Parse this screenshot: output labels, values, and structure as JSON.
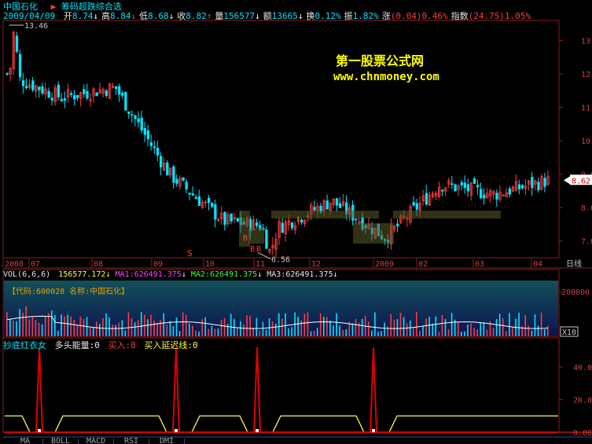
{
  "stock": {
    "name": "中国石化",
    "formula_name": "筹码超跌综合选",
    "date": "2009/04/09"
  },
  "quote": [
    {
      "label": "开",
      "value": "8.74",
      "arrow": "↓",
      "arrow_color": "#ffffff"
    },
    {
      "label": "高",
      "value": "8.84",
      "arrow": "↓",
      "arrow_color": "#ff3c3c"
    },
    {
      "label": "低",
      "value": "8.68",
      "arrow": "↓",
      "arrow_color": "#ffffff"
    },
    {
      "label": "收",
      "value": "8.82",
      "arrow": "↑",
      "arrow_color": "#ff3c3c"
    },
    {
      "label": "量",
      "value": "156577",
      "arrow": "↓",
      "arrow_color": "#ffffff"
    },
    {
      "label": "额",
      "value": "13665",
      "arrow": "↓",
      "arrow_color": "#ffffff"
    },
    {
      "label": "换",
      "value": "0.12%",
      "arrow": "",
      "arrow_color": ""
    },
    {
      "label": "振",
      "value": "1.82%",
      "arrow": "",
      "arrow_color": ""
    },
    {
      "label": "涨",
      "value": "(0.04)0.46%",
      "arrow": "",
      "arrow_color": ""
    },
    {
      "label": "指数",
      "value": "(24.75)1.05%",
      "arrow": "",
      "arrow_color": ""
    }
  ],
  "watermark": {
    "line1": "第一股票公式网",
    "line2": "www.chnmoney.com"
  },
  "price_axis": {
    "ticks": [
      "13.00",
      "12.00",
      "11.00",
      "10.00",
      "9.00",
      "8.00",
      "7.00"
    ],
    "current_price": "8.62"
  },
  "annotations": {
    "high": "13.46",
    "low": "6.56",
    "s_marker": "S",
    "b_marker": "B"
  },
  "time_axis": {
    "labels": [
      "2008",
      "07",
      "08",
      "09",
      "10",
      "11",
      "12",
      "2009",
      "02",
      "03",
      "04"
    ],
    "period": "日线"
  },
  "volume": {
    "title": "VOL(6,6,6)",
    "vol_value": "156577.172",
    "vol_arrow": "↓",
    "ma1": "MA1:626491.375",
    "ma1_arrow": "↓",
    "ma2": "MA2:626491.375",
    "ma2_arrow": "↓",
    "ma3": "MA3:626491.375",
    "ma3_arrow": "↓",
    "info": "【代码:600028 名称:中国石化】",
    "axis_tick": "200000",
    "multiplier": "X10"
  },
  "indicator": {
    "name": "抄底红衣女",
    "l1": "多头能量:0",
    "l2": "买入:0",
    "l3": "买入延迟线:0",
    "ticks": [
      "40.00",
      "20.00",
      "0.00"
    ]
  },
  "tabs": [
    "MA",
    "BOLL",
    "MACD",
    "RSI",
    "DMI"
  ],
  "colors": {
    "background": "#000000",
    "up": "#ff3c3c",
    "down": "#00e5ff",
    "grid": "#8a1e1e",
    "ma_line": "#ffffff",
    "signal_line": "#ffff50",
    "indicator_red": "#e00000"
  },
  "chart_data": [
    {
      "type": "candlestick",
      "title": "中国石化",
      "x": [
        "2008/06",
        "2008/07",
        "2008/08",
        "2008/09",
        "2008/10",
        "2008/11",
        "2008/12",
        "2009/01",
        "2009/02",
        "2009/03",
        "2009/04"
      ],
      "close": [
        12.0,
        11.3,
        11.6,
        9.0,
        7.6,
        7.4,
        8.2,
        7.1,
        8.7,
        8.4,
        8.82
      ],
      "ylim": [
        6.5,
        13.6
      ],
      "high": 13.46,
      "low": 6.56
    },
    {
      "type": "bar",
      "title": "VOL(6,6,6)",
      "ylim": [
        0,
        250000
      ]
    },
    {
      "type": "line",
      "title": "抄底红衣女",
      "series": [
        {
          "name": "多头能量",
          "values": [
            0,
            52,
            0,
            0,
            52,
            0,
            0,
            52,
            0,
            0,
            52,
            0
          ]
        },
        {
          "name": "买入延迟线",
          "values": [
            10,
            10,
            0,
            10,
            10,
            0,
            10,
            10,
            0,
            10,
            10,
            0
          ]
        }
      ],
      "ylim": [
        0,
        55
      ]
    }
  ]
}
